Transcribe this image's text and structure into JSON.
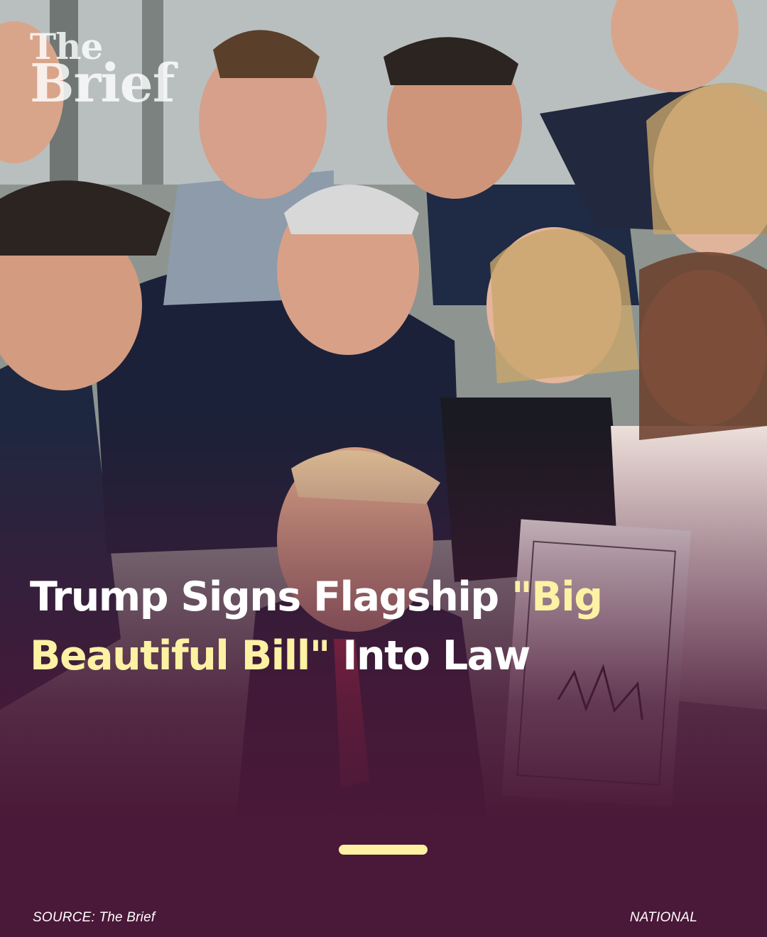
{
  "brand": {
    "line1": "The",
    "line2": "Brief"
  },
  "headline": {
    "part1": "Trump Signs Flagship ",
    "highlight1": "\"Big",
    "highlight2": "Beautiful Bill\"",
    "part2": " Into Law"
  },
  "footer": {
    "source": "SOURCE: The Brief",
    "category": "NATIONAL"
  },
  "colors": {
    "background": "#4a1838",
    "accent": "#fdf1a3",
    "text": "#ffffff"
  },
  "pagination": {
    "active_index": 0
  }
}
